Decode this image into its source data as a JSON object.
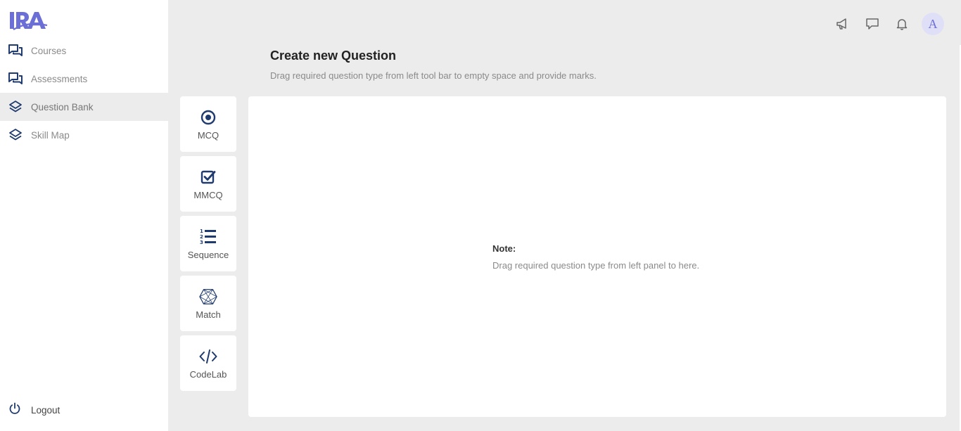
{
  "app": {
    "logo_text": "IRA",
    "accent": "#6b6fd6",
    "icon_color": "#1f3a6e"
  },
  "sidebar": {
    "items": [
      {
        "label": "Courses",
        "icon": "chat-bubbles-icon",
        "active": false
      },
      {
        "label": "Assessments",
        "icon": "chat-bubbles-icon",
        "active": false
      },
      {
        "label": "Question Bank",
        "icon": "layers-icon",
        "active": true
      },
      {
        "label": "Skill Map",
        "icon": "layers-icon",
        "active": false
      }
    ],
    "logout_label": "Logout"
  },
  "topbar": {
    "icons": [
      "megaphone-icon",
      "message-icon",
      "bell-icon"
    ],
    "avatar_initial": "A"
  },
  "main": {
    "title": "Create new Question",
    "subtitle": "Drag required question type from left tool bar to empty space and provide marks.",
    "tools": [
      {
        "label": "MCQ",
        "icon": "radio-dot-icon"
      },
      {
        "label": "MMCQ",
        "icon": "checkbox-icon"
      },
      {
        "label": "Sequence",
        "icon": "numbered-list-icon"
      },
      {
        "label": "Match",
        "icon": "hexagon-mesh-icon"
      },
      {
        "label": "CodeLab",
        "icon": "code-icon"
      }
    ],
    "dropzone": {
      "note_title": "Note:",
      "note_text": "Drag required question type from left panel to here."
    }
  }
}
